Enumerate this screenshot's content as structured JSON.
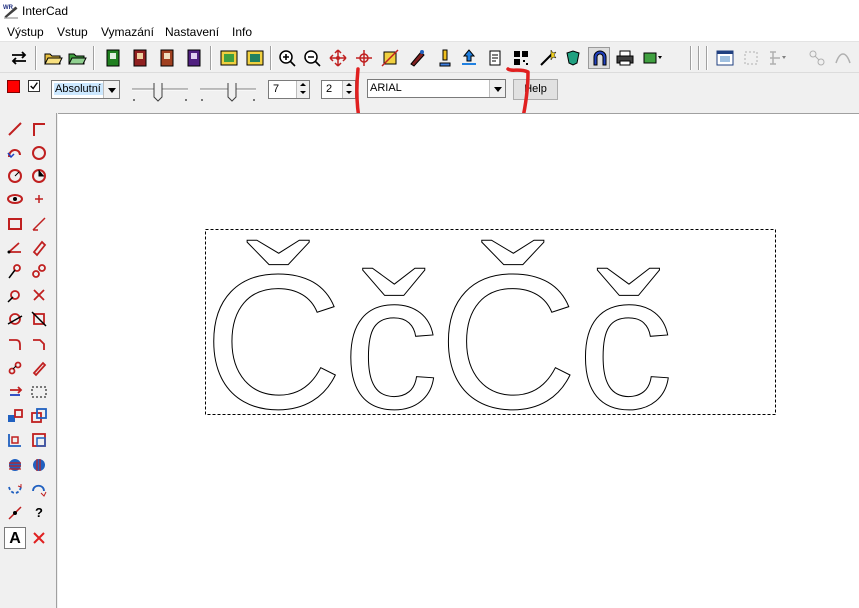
{
  "app": {
    "title": "InterCad",
    "icon": "intercad-app-icon"
  },
  "menu": [
    {
      "label": "Výstup"
    },
    {
      "label": "Vstup"
    },
    {
      "label": "Vymazání"
    },
    {
      "label": "Nastavení"
    },
    {
      "label": "Info"
    }
  ],
  "toolbar": {
    "mode": "Absolutní",
    "spin1": "7",
    "spin2": "2",
    "font": "ARIAL",
    "help": "Help",
    "color": "#ff0000",
    "checkbox_checked": true
  },
  "left_tools": {
    "text_tool_label": "A",
    "help_tool_label": "?"
  },
  "drawing": {
    "text": "ČčČč",
    "stroke": "#000000"
  },
  "annotation_color": "#e02020"
}
